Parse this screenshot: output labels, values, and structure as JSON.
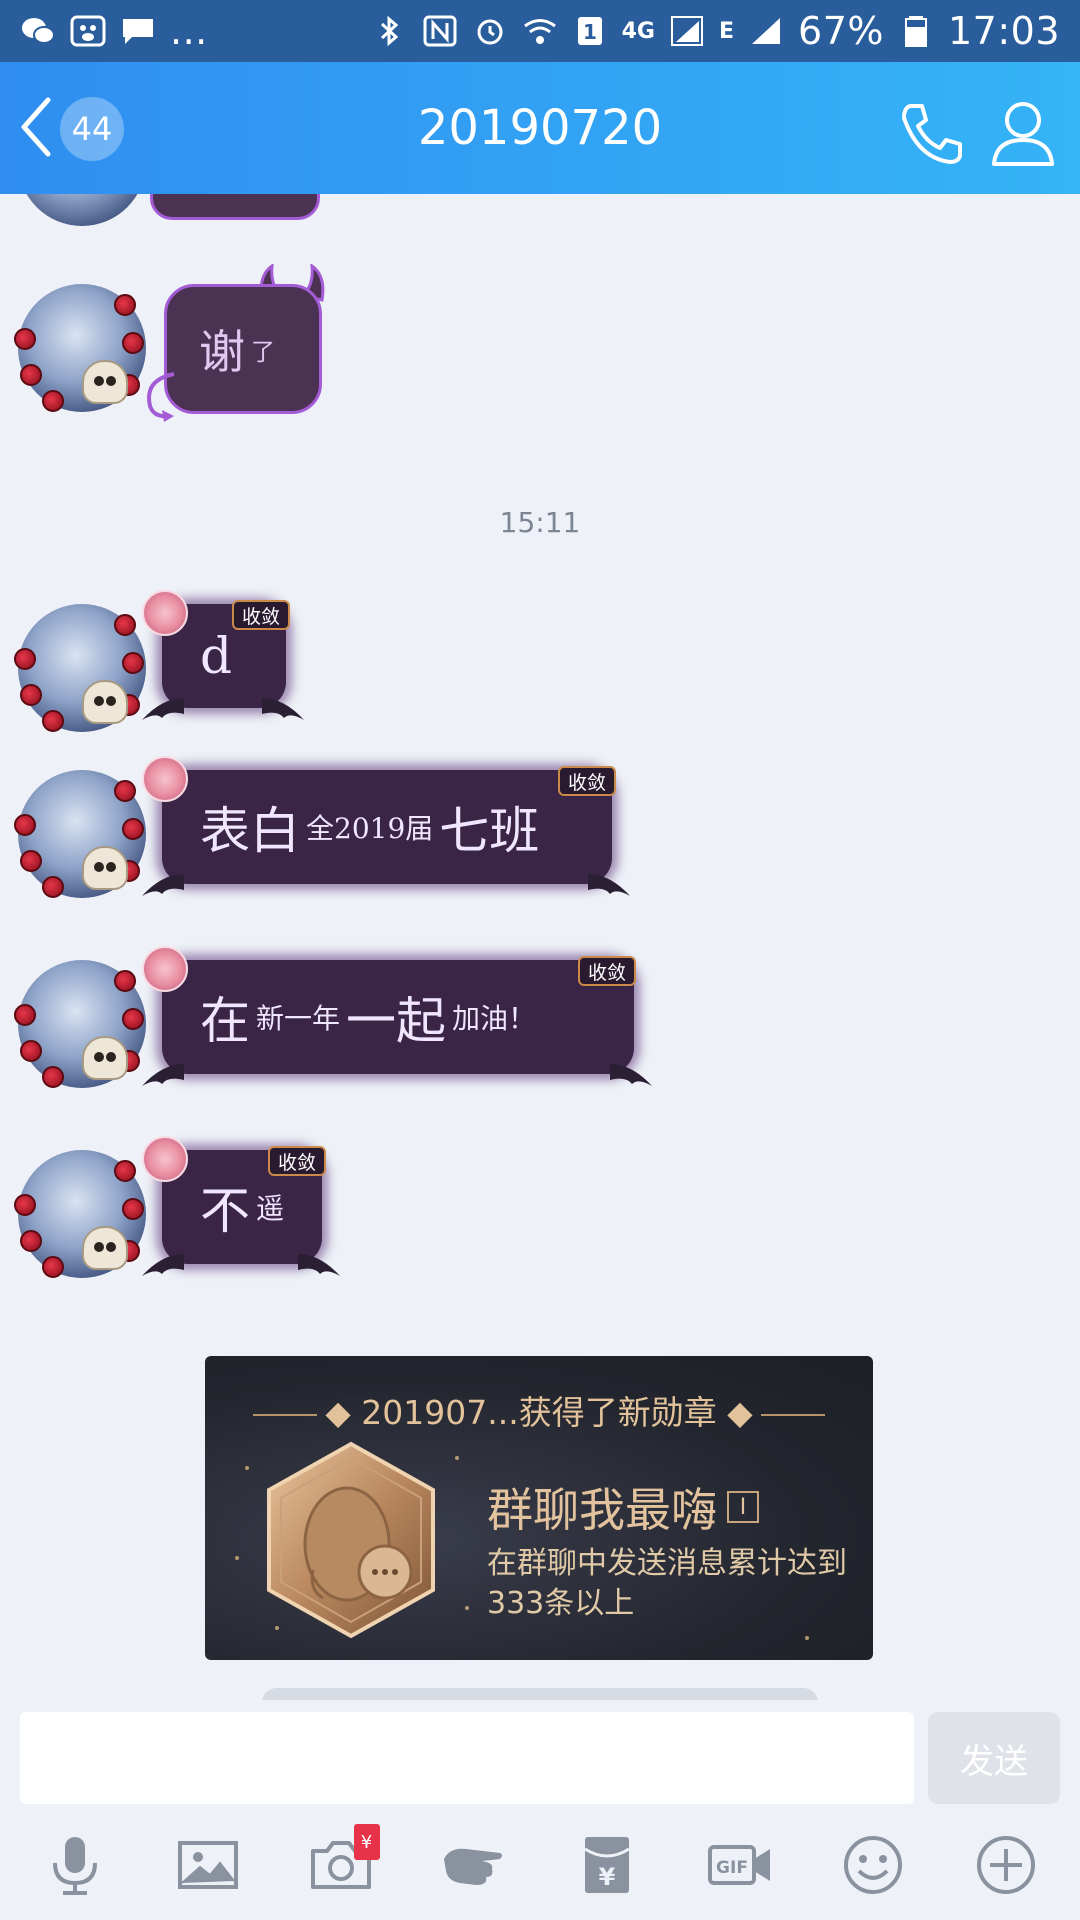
{
  "status_bar": {
    "battery_percent": "67%",
    "time": "17:03",
    "network_type": "4G",
    "network_secondary": "E",
    "sim_slot": "1",
    "overflow": "...",
    "icons": [
      "wechat-icon",
      "baidu-icon",
      "message-icon",
      "bluetooth-icon",
      "nfc-icon",
      "alarm-icon",
      "wifi-icon",
      "signal-icon",
      "battery-icon"
    ]
  },
  "header": {
    "unread_count": "44",
    "title": "20190720"
  },
  "chat": {
    "timestamp": "15:11",
    "devil_message": {
      "big": "谢",
      "small": "了"
    },
    "messages": [
      {
        "tag": "收敛",
        "parts": [
          {
            "text": "d",
            "size": "big"
          }
        ]
      },
      {
        "tag": "收敛",
        "parts": [
          {
            "text": "表白",
            "size": "big"
          },
          {
            "text": "全2019届",
            "size": "small"
          },
          {
            "text": "七班",
            "size": "big"
          }
        ]
      },
      {
        "tag": "收敛",
        "parts": [
          {
            "text": "在",
            "size": "big"
          },
          {
            "text": "新一年",
            "size": "small"
          },
          {
            "text": "一起",
            "size": "big"
          },
          {
            "text": "加油！",
            "size": "small"
          }
        ]
      },
      {
        "tag": "收敛",
        "parts": [
          {
            "text": "不",
            "size": "big"
          },
          {
            "text": "遥",
            "size": "small"
          }
        ]
      }
    ],
    "medal": {
      "title": "201907...获得了新勋章",
      "name": "群聊我最嗨",
      "level": "I",
      "description": "在群聊中发送消息累计达到333条以上"
    }
  },
  "input": {
    "placeholder": "",
    "send_label": "发送"
  },
  "toolbar": {
    "red_packet_badge": "¥",
    "gif_label": "GIF",
    "items": [
      "microphone-icon",
      "image-icon",
      "camera-icon",
      "poke-icon",
      "red-packet-icon",
      "gif-icon",
      "emoji-icon",
      "plus-icon"
    ]
  },
  "colors": {
    "header_start": "#2f8ef0",
    "header_end": "#35b4f7",
    "status_bar": "#2a5d9b",
    "bubble": "#3a2547",
    "medal_gold": "#e2c29a"
  }
}
